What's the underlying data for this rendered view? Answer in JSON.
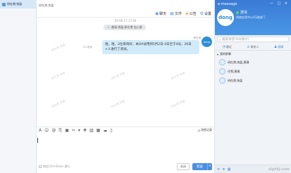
{
  "conversation_list": {
    "items": [
      {
        "label": "研在港,快盈"
      }
    ]
  },
  "header": {
    "title": "研在港,快盈",
    "tabs": [
      {
        "icon": "chat-icon",
        "label": "聊天"
      },
      {
        "icon": "file-icon",
        "label": "文件"
      },
      {
        "icon": "announcement-icon",
        "label": "公告"
      },
      {
        "icon": "settings-icon",
        "label": "设置"
      }
    ]
  },
  "chat": {
    "timestamp": "05-08 17:17:59",
    "notice": "邀请 快盈,研在港 加入群",
    "watermark_text": "研在港,快盈",
    "unread": "2人未读",
    "message": {
      "sender": "研在港",
      "avatar": "dong",
      "text": "哈。哈。2位哥哥好，本OA试用到5月2日-4日至于4号。26日+人进行了测试。"
    }
  },
  "history_label": "消息记录",
  "footer": {
    "hint": "按住Ctrl+Enter 换行",
    "close_label": "关闭",
    "send_label": "发送",
    "send_arrow": "▾"
  },
  "right_panel": {
    "app_title": "e-message",
    "window_controls": "— □ ×",
    "avatar": "dong",
    "user_name": "游泳",
    "user_info": "网络信息中心/行政部门",
    "search_placeholder": "搜索(拼音/字母/数字)",
    "tabs": [
      {
        "icon": "recent-icon",
        "label": "最近"
      },
      {
        "icon": "contacts-icon",
        "label": "联系人"
      },
      {
        "icon": "group-icon",
        "label": "群聊"
      }
    ],
    "group_header": "我的群聊",
    "groups": [
      {
        "label": "研在港,快盈,黄璞"
      },
      {
        "label": "任雪,黄璞"
      },
      {
        "label": "研在港,快盈"
      }
    ],
    "brand": "zigkkj.com"
  },
  "colors": {
    "accent": "#4a90e2",
    "bubble": "#d2ebfb",
    "header": "#3a7bd5"
  }
}
